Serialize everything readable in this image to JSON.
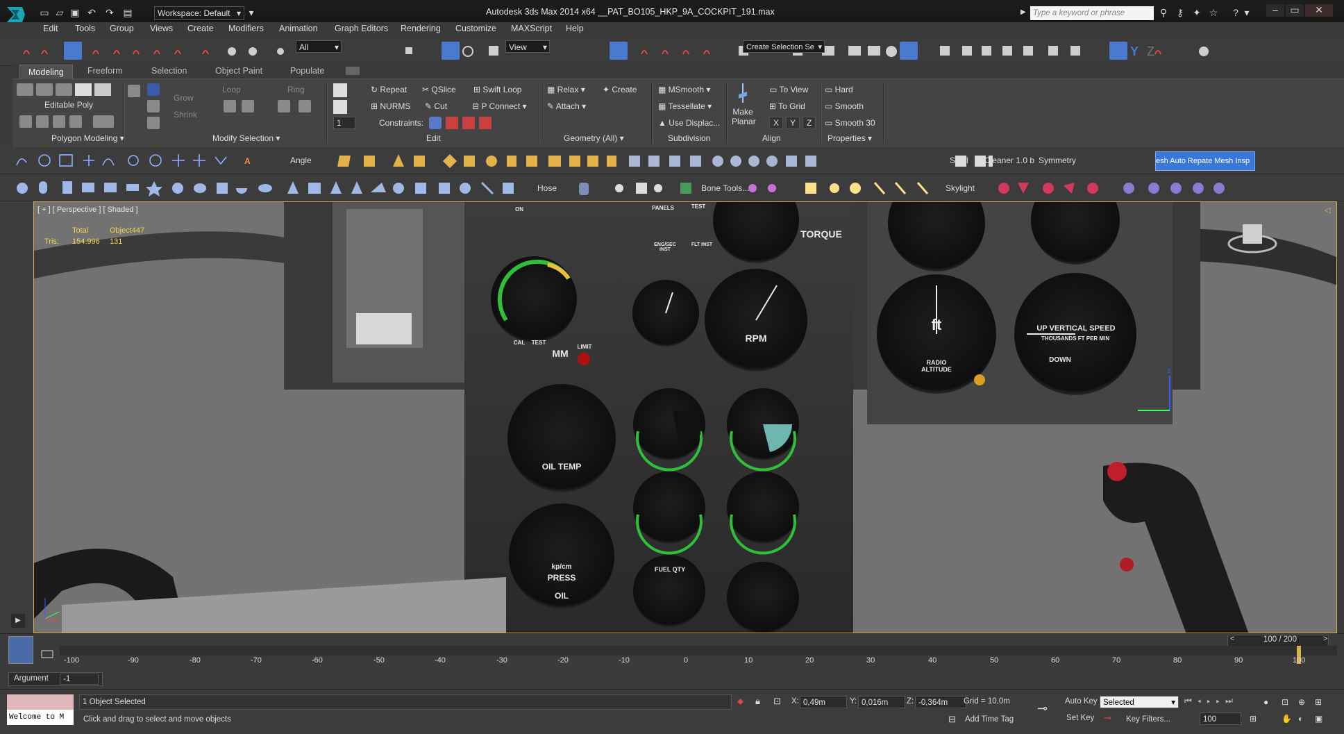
{
  "titlebar": {
    "workspace": "Workspace: Default",
    "app_title": "Autodesk 3ds Max  2014 x64      __PAT_BO105_HKP_9A_COCKPIT_191.max",
    "search_placeholder": "Type a keyword or phrase"
  },
  "menu": [
    "Edit",
    "Tools",
    "Group",
    "Views",
    "Create",
    "Modifiers",
    "Animation",
    "Graph Editors",
    "Rendering",
    "Customize",
    "MAXScript",
    "Help"
  ],
  "maintoolbar": {
    "filter": "All",
    "refcoord": "View",
    "selection_set": "Create Selection Se"
  },
  "ribbon_tabs": [
    "Modeling",
    "Freeform",
    "Selection",
    "Object Paint",
    "Populate"
  ],
  "ribbon": {
    "editable_poly": "Editable Poly",
    "polygon_modeling": "Polygon Modeling",
    "grow": "Grow",
    "shrink": "Shrink",
    "loop": "Loop",
    "ring": "Ring",
    "modify_selection": "Modify Selection",
    "repeat": "Repeat",
    "qslice": "QSlice",
    "swift_loop": "Swift Loop",
    "nurms": "NURMS",
    "cut": "Cut",
    "p_connect": "P Connect",
    "constraints": "Constraints:",
    "edit": "Edit",
    "relax": "Relax",
    "create": "Create",
    "attach": "Attach",
    "geometry_all": "Geometry (All)",
    "msmooth": "MSmooth",
    "tessellate": "Tessellate",
    "use_displac": "Use Displac...",
    "subdivision": "Subdivision",
    "make_planar_1": "Make",
    "make_planar_2": "Planar",
    "x": "X",
    "y": "Y",
    "z": "Z",
    "to_view": "To View",
    "to_grid": "To Grid",
    "align": "Align",
    "hard": "Hard",
    "smooth": "Smooth",
    "smooth30": "Smooth 30",
    "properties": "Properties",
    "spinner_value": "1"
  },
  "toolbar2": {
    "angle": "Angle",
    "shell": "Shell",
    "cleaner": "Cleaner 1.0 b",
    "symmetry": "Symmetry",
    "mesh_btn": "esh Auto Repate Mesh Insp"
  },
  "toolbar3": {
    "hose": "Hose",
    "bone_tools": "Bone Tools...",
    "skylight": "Skylight"
  },
  "viewport": {
    "label": "[ + ] [ Perspective ] [ Shaded ]",
    "stats_total": "Total",
    "stats_object": "Object447",
    "stats_tris": "Tris:",
    "stats_total_val": "154.996",
    "stats_obj_val": "131",
    "gauge_texts": {
      "torque": "TORQUE",
      "rpm": "RPM",
      "ft": "ft",
      "vertical_speed": "UP VERTICAL SPEED",
      "vs_sub": "THOUSANDS FT PER MIN",
      "down": "DOWN",
      "oil_temp": "OIL TEMP",
      "press": "PRESS",
      "oil": "OIL",
      "kpcm": "kp/cm",
      "fuel_qty": "FUEL QTY",
      "mm": "MM",
      "radio_altitude": "RADIO ALTITUDE",
      "cal": "CAL",
      "test": "TEST",
      "limit": "LIMIT",
      "panels": "PANELS",
      "test2": "TEST",
      "eng_inst": "ENG/SEC INST",
      "flt_inst": "FLT INST",
      "on": "ON"
    }
  },
  "timeline": {
    "counter": "100 / 200",
    "ticks": [
      "-100",
      "-90",
      "-80",
      "-70",
      "-60",
      "-50",
      "-40",
      "-30",
      "-20",
      "-10",
      "0",
      "10",
      "20",
      "30",
      "40",
      "50",
      "60",
      "70",
      "80",
      "90",
      "100"
    ]
  },
  "status": {
    "argument_label": "Argument",
    "argument_value": "-1",
    "selected": "1 Object Selected",
    "prompt": "Click and drag to select and move objects",
    "welcome": "Welcome to M",
    "x_label": "X:",
    "x_val": "0,49m",
    "y_label": "Y:",
    "y_val": "0,016m",
    "z_label": "Z:",
    "z_val": "-0,364m",
    "grid": "Grid = 10,0m",
    "auto_key": "Auto Key",
    "set_key": "Set Key",
    "key_select": "Selected",
    "key_filters": "Key Filters...",
    "add_time_tag": "Add Time Tag",
    "frame": "100"
  },
  "colors": {
    "accent": "#d6b34a",
    "stats": "#f5d74e",
    "active_blue": "#3b5aa8",
    "gauge_green": "#2fbf3a"
  }
}
